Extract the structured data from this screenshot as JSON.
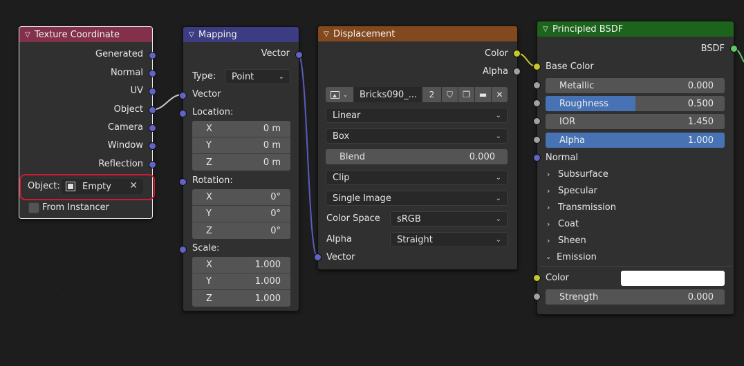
{
  "texture_coordinate": {
    "title": "Texture Coordinate",
    "header_color": "#83314a",
    "outputs": [
      "Generated",
      "Normal",
      "UV",
      "Object",
      "Camera",
      "Window",
      "Reflection"
    ],
    "object_label": "Object:",
    "object_value": "Empty",
    "from_instancer": "From Instancer"
  },
  "mapping": {
    "title": "Mapping",
    "header_color": "#3c3c83",
    "output_vector": "Vector",
    "type_label": "Type:",
    "type_value": "Point",
    "input_vector": "Vector",
    "location_label": "Location:",
    "location": [
      {
        "axis": "X",
        "value": "0 m"
      },
      {
        "axis": "Y",
        "value": "0 m"
      },
      {
        "axis": "Z",
        "value": "0 m"
      }
    ],
    "rotation_label": "Rotation:",
    "rotation": [
      {
        "axis": "X",
        "value": "0°"
      },
      {
        "axis": "Y",
        "value": "0°"
      },
      {
        "axis": "Z",
        "value": "0°"
      }
    ],
    "scale_label": "Scale:",
    "scale": [
      {
        "axis": "X",
        "value": "1.000"
      },
      {
        "axis": "Y",
        "value": "1.000"
      },
      {
        "axis": "Z",
        "value": "1.000"
      }
    ]
  },
  "displacement": {
    "title": "Displacement",
    "header_color": "#83491e",
    "output_color": "Color",
    "output_alpha": "Alpha",
    "image_name": "Bricks090_...",
    "user_count": "2",
    "interpolation": "Linear",
    "projection": "Box",
    "blend_label": "Blend",
    "blend_value": "0.000",
    "extension": "Clip",
    "source": "Single Image",
    "color_space_label": "Color Space",
    "color_space_value": "sRGB",
    "alpha_label": "Alpha",
    "alpha_value": "Straight",
    "input_vector": "Vector"
  },
  "principled": {
    "title": "Principled BSDF",
    "header_color": "#1c631c",
    "output": "BSDF",
    "base_color": "Base Color",
    "metallic_label": "Metallic",
    "metallic_value": "0.000",
    "roughness_label": "Roughness",
    "roughness_value": "0.500",
    "roughness_fraction": 0.5,
    "ior_label": "IOR",
    "ior_value": "1.450",
    "alpha_label": "Alpha",
    "alpha_value": "1.000",
    "alpha_fraction": 1.0,
    "normal": "Normal",
    "panels": [
      "Subsurface",
      "Specular",
      "Transmission",
      "Coat",
      "Sheen"
    ],
    "emission": "Emission",
    "emission_color_label": "Color",
    "emission_color": "#ffffff",
    "strength_label": "Strength",
    "strength_value": "0.000"
  },
  "colors": {
    "vector_socket": "#6363c7",
    "color_socket": "#c7c729",
    "float_socket": "#a1a1a1",
    "shader_socket": "#63c763",
    "annotation": "#d01a35",
    "slider_fill": "#4772b3"
  }
}
